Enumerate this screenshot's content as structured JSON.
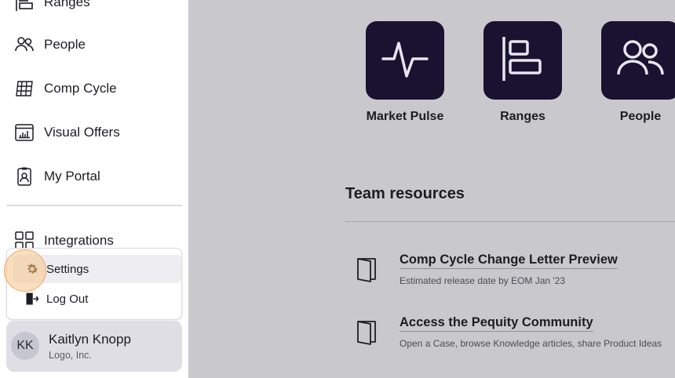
{
  "sidebar": {
    "nav": [
      {
        "label": "Ranges",
        "icon": "ranges-icon"
      },
      {
        "label": "People",
        "icon": "people-icon"
      },
      {
        "label": "Comp Cycle",
        "icon": "grid-calendar-icon"
      },
      {
        "label": "Visual Offers",
        "icon": "chart-window-icon"
      },
      {
        "label": "My Portal",
        "icon": "badge-icon"
      },
      {
        "label": "Integrations",
        "icon": "integrations-grid-icon"
      }
    ],
    "menu": {
      "settings_label": "Settings",
      "logout_label": "Log Out"
    },
    "user": {
      "initials": "KK",
      "name": "Kaitlyn Knopp",
      "org": "Logo, Inc."
    }
  },
  "main": {
    "apps": [
      {
        "label": "Market Pulse",
        "icon": "pulse-icon"
      },
      {
        "label": "Ranges",
        "icon": "ranges-icon"
      },
      {
        "label": "People",
        "icon": "people-icon"
      }
    ],
    "team_resources": {
      "title": "Team resources",
      "items": [
        {
          "title": "Comp Cycle Change Letter Preview",
          "description": "Estimated release date by EOM Jan '23"
        },
        {
          "title": "Access the Pequity Community",
          "description": "Open a Case, browse Knowledge articles, share Product Ideas"
        }
      ]
    }
  },
  "colors": {
    "tile_bg": "#1a1230",
    "overlay_bg": "#c9c9cd",
    "highlight": "#f2a866"
  }
}
